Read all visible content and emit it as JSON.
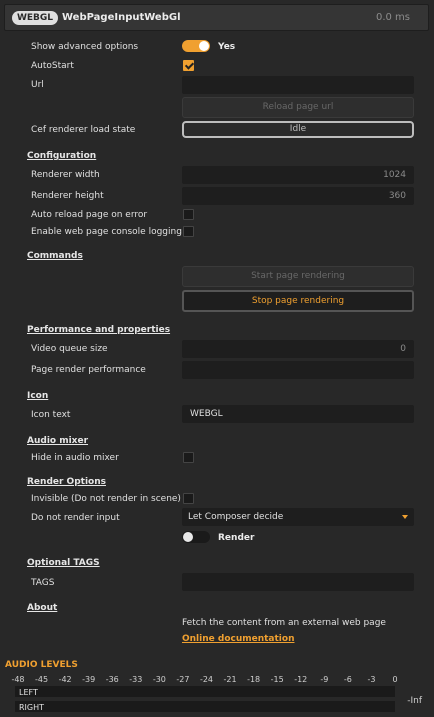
{
  "header": {
    "badge": "WEBGL",
    "title": "WebPageInputWebGl",
    "time": "0.0 ms"
  },
  "general": {
    "show_advanced_label": "Show advanced options",
    "show_advanced_value": "Yes",
    "autostart_label": "AutoStart",
    "url_label": "Url",
    "url_value": "",
    "reload_button": "Reload page url",
    "cef_state_label": "Cef renderer load state",
    "cef_state_value": "Idle"
  },
  "configuration": {
    "title": "Configuration",
    "width_label": "Renderer width",
    "width_value": "1024",
    "height_label": "Renderer height",
    "height_value": "360",
    "auto_reload_label": "Auto reload page on error",
    "console_logging_label": "Enable web page console logging"
  },
  "commands": {
    "title": "Commands",
    "start_button": "Start page rendering",
    "stop_button": "Stop page rendering"
  },
  "performance": {
    "title": "Performance and properties",
    "video_queue_label": "Video queue size",
    "video_queue_value": "0",
    "render_perf_label": "Page render performance",
    "render_perf_value": ""
  },
  "icon": {
    "title": "Icon",
    "icon_text_label": "Icon text",
    "icon_text_value": "WEBGL"
  },
  "audio_mixer": {
    "title": "Audio mixer",
    "hide_label": "Hide in audio mixer"
  },
  "render_options": {
    "title": "Render Options",
    "invisible_label": "Invisible (Do not render in scene)",
    "no_render_input_label": "Do not render input",
    "no_render_input_value": "Let Composer decide",
    "render_toggle_label": "Render"
  },
  "tags": {
    "title": "Optional TAGS",
    "tags_label": "TAGS",
    "tags_value": ""
  },
  "about": {
    "title": "About",
    "description": "Fetch the content from an external web page",
    "doc_link": "Online documentation"
  },
  "audio_levels": {
    "title": "AUDIO LEVELS",
    "ticks": [
      "-48",
      "-45",
      "-42",
      "-39",
      "-36",
      "-33",
      "-30",
      "-27",
      "-24",
      "-21",
      "-18",
      "-15",
      "-12",
      "-9",
      "-6",
      "-3",
      "0"
    ],
    "left_label": "LEFT",
    "right_label": "RIGHT",
    "inf_label": "-Inf"
  },
  "colors": {
    "accent": "#f0a030",
    "background": "#282828",
    "field": "#1e1e1e"
  }
}
